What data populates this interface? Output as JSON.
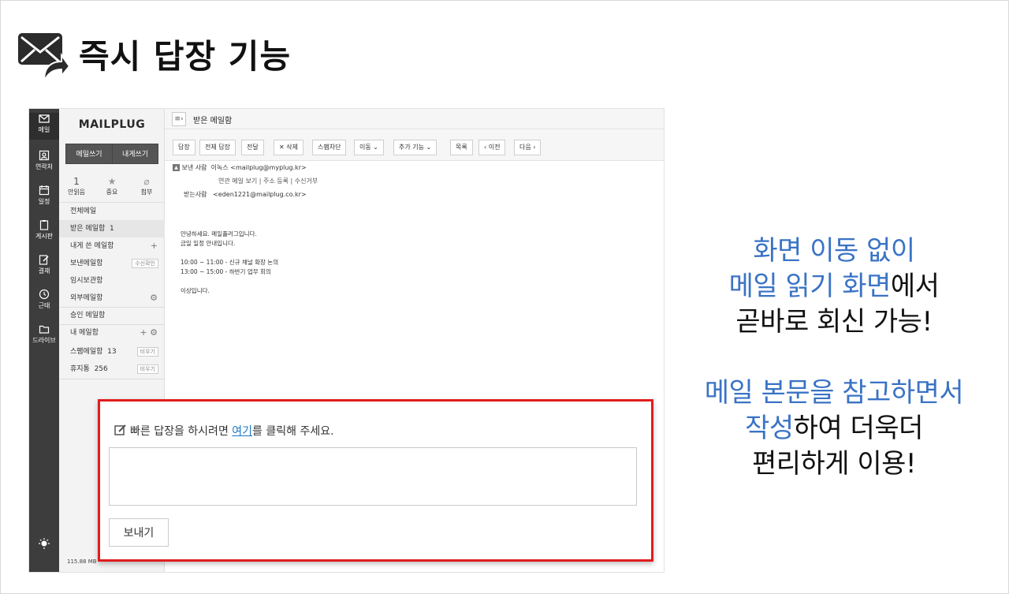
{
  "title": "즉시 답장 기능",
  "rail": [
    {
      "icon": "mail-icon",
      "label": "메일"
    },
    {
      "icon": "contacts-icon",
      "label": "연락처"
    },
    {
      "icon": "calendar-icon",
      "label": "일정"
    },
    {
      "icon": "board-icon",
      "label": "게시판"
    },
    {
      "icon": "approval-icon",
      "label": "결재"
    },
    {
      "icon": "clock-icon",
      "label": "근태"
    },
    {
      "icon": "folder-icon",
      "label": "드라이브"
    }
  ],
  "sidebar": {
    "logo": "MAILPLUG",
    "write_mail": "메일쓰기",
    "write_self": "내게쓰기",
    "stats": [
      {
        "value": "1",
        "label": "안읽음"
      },
      {
        "value": "★",
        "label": "중요"
      },
      {
        "value": "⌀",
        "label": "첨부"
      }
    ],
    "folders": [
      {
        "label": "전체메일"
      },
      {
        "label": "받은 메일함",
        "count": "1"
      },
      {
        "label": "내게 쓴 메일함"
      },
      {
        "label": "보낸메일함",
        "tag": "수신확인"
      },
      {
        "label": "임시보관함"
      },
      {
        "label": "외부메일함"
      },
      {
        "label": "승인 메일함"
      },
      {
        "label": "내 메일함"
      },
      {
        "label": "스팸메일함",
        "count": "13",
        "tag": "비우기"
      },
      {
        "label": "휴지통",
        "count": "256",
        "tag": "비우기"
      }
    ],
    "storage": "115.88 MB"
  },
  "main": {
    "title": "받은 메일함",
    "toolbar": {
      "reply": "답장",
      "reply_all": "전체 답장",
      "forward": "전달",
      "delete": "✕ 삭제",
      "spam": "스팸차단",
      "move": "이동 ⌄",
      "more": "추가 기능 ⌄",
      "list": "목록",
      "prev": "‹ 이전",
      "next": "다음 ›"
    },
    "sender_label": "보낸 사람",
    "sender": "이녹스 <mailplug@myplug.kr>",
    "sender_links": "연관 메일 보기 | 주소 등록 | 수신거부",
    "recipient_label": "받는사람",
    "recipient": "<eden1221@mailplug.co.kr>",
    "body": [
      "안녕하세요. 메일플러그입니다.",
      "금일 일정 안내입니다.",
      "",
      "10:00 ~ 11:00 - 신규 채널 확장 논의",
      "13:00 ~ 15:00 - 하반기 업무 회의",
      "",
      "이상입니다."
    ]
  },
  "quick_reply": {
    "prefix": "빠른 답장을 하시려면 ",
    "link": "여기",
    "suffix": "를 클릭해 주세요.",
    "send": "보내기"
  },
  "copy": {
    "line1": "화면 이동 없이",
    "line2_blue": "메일 읽기 화면",
    "line2_rest": "에서",
    "line3": "곧바로 회신 가능!",
    "line4": "메일 본문을 참고하면서",
    "line5_blue": "작성",
    "line5_rest": "하여 더욱더",
    "line6": "편리하게 이용!"
  },
  "colors": {
    "accent_blue": "#3a73c5",
    "highlight_red": "#e11d1d",
    "rail_bg": "#3d3d3d"
  }
}
